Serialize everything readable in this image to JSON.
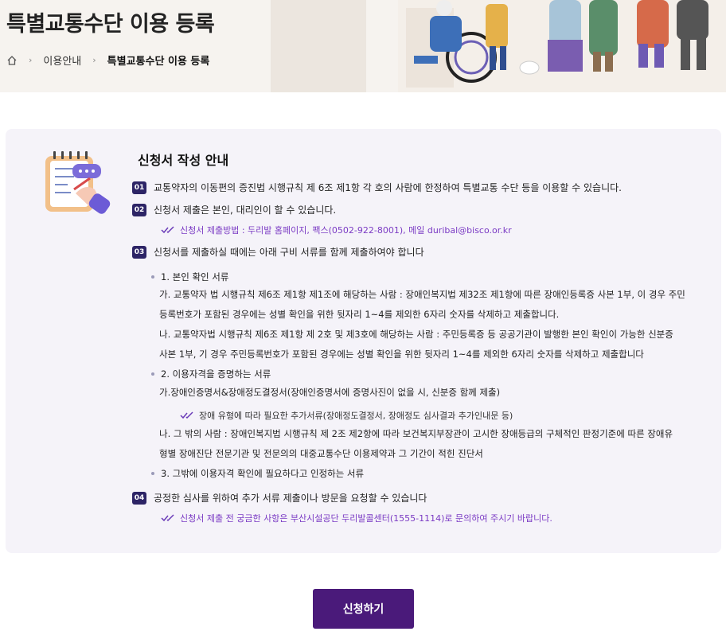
{
  "header": {
    "title": "특별교통수단 이용 등록",
    "breadcrumb": {
      "home_icon": "home-icon",
      "items": [
        "이용안내",
        "특별교통수단 이용 등록"
      ]
    }
  },
  "guide": {
    "icon": "clipboard-writing-icon",
    "title": "신청서 작성 안내",
    "items": [
      {
        "num": "01",
        "text": "교통약자의 이동편의 증진법 시행규칙 제 6조 제1항 각 호의 사람에 한정하여 특별교통 수단 등을 이용할 수 있습니다."
      },
      {
        "num": "02",
        "text": "신청서 제출은 본인, 대리인이 할 수 있습니다.",
        "note": "신청서 제출방법 : 두리발 홈페이지, 팩스(0502-922-8001), 메일 duribal@bisco.or.kr"
      },
      {
        "num": "03",
        "text": "신청서를 제출하실 때에는 아래 구비 서류를 함께 제출하여야 합니다"
      },
      {
        "num": "04",
        "text": "공정한 심사를 위하여 추가 서류 제출이나 방문을 요청할 수 있습니다",
        "note": "신청서 제출 전 궁금한 사항은 부산시설공단 두리발콜센터(1555-1114)로 문의하여 주시기 바랍니다."
      }
    ],
    "documents": {
      "sec1_title": "1. 본인 확인 서류",
      "sec1_a_line1": "가. 교통약자 법 시행규칙 제6조 제1항 제1조에 해당하는 사람 : 장애인복지법 제32조 제1항에 따른 장애인등록증 사본 1부, 이 경우 주민",
      "sec1_a_line2": "등록번호가 포함된 경우에는 성별 확인을 위한 뒷자리 1~4를 제외한 6자리 숫자를 삭제하고 제출합니다.",
      "sec1_b_line1": "나. 교통약자법 시행규칙 제6조 제1항 제 2호 및 제3호에 해당하는 사람 : 주민등록증 등 공공기관이 발행한 본인 확인이 가능한 신분증",
      "sec1_b_line2": "사본 1부, 기 경우 주민등록번호가 포함된 경우에는 성별 확인을 위한 뒷자리 1~4를 제외한 6자리 숫자를 삭제하고 제출합니다",
      "sec2_title": "2. 이용자격을 증명하는 서류",
      "sec2_a": "가.장애인증명서&장애정도결정서(장애인증명서에 증명사진이 없을 시, 신분증 함께 제출)",
      "sec2_note": "장애 유형에 따라 필요한 추가서류(장애정도결정서, 장애정도 심사결과 추가인내문 등)",
      "sec2_b_line1": "나. 그 밖의 사람 : 장애인복지법 시행규칙 제 2조 제2항에 따라 보건복지부장관이 고시한 장애등급의 구체적인 판정기준에 따른 장애유",
      "sec2_b_line2": "형별 장애진단 전문기관 및 전문의의 대중교통수단 이용제약과 그 기간이 적힌 진단서",
      "sec3_title": "3. 그밖에 이용자격 확인에 필요하다고 인정하는 서류"
    }
  },
  "apply_button": "신청하기",
  "colors": {
    "badge": "#2d2466",
    "note": "#7b3bc4",
    "button": "#4a1a7a",
    "box_bg": "#f5f3f9"
  }
}
